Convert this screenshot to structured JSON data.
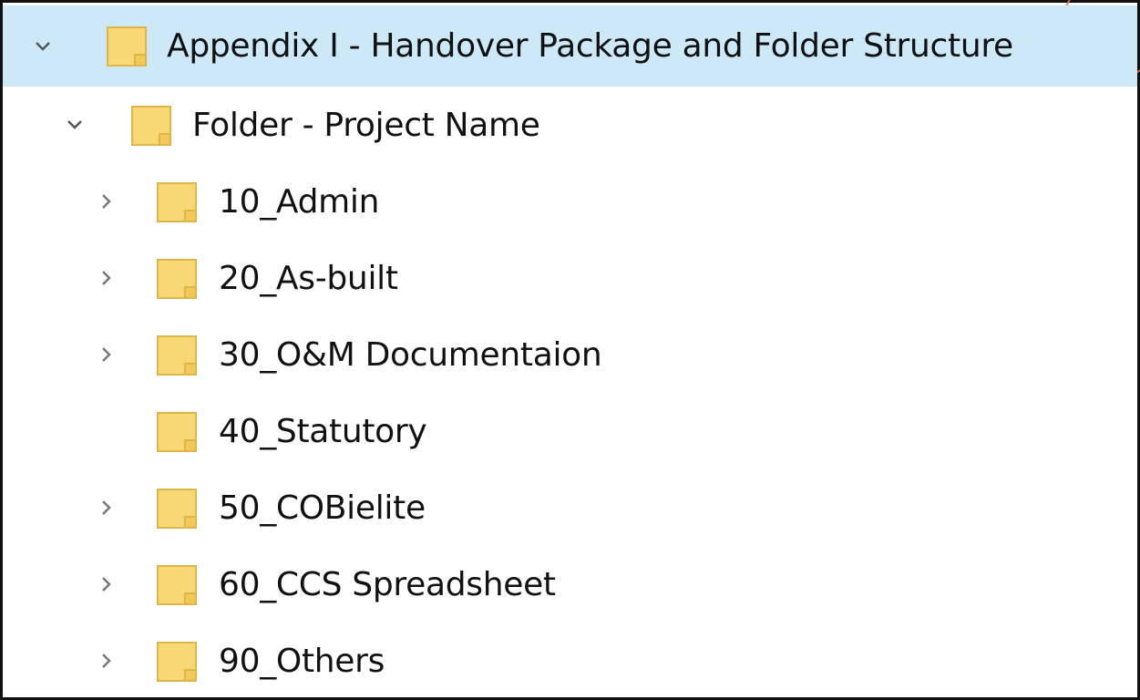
{
  "tree": {
    "items": [
      {
        "label": "Appendix I - Handover Package and Folder Structure",
        "expander": "chevron-down",
        "selected": true,
        "level": 0
      },
      {
        "label": "Folder - Project Name",
        "expander": "chevron-down",
        "selected": false,
        "level": 1
      },
      {
        "label": "10_Admin",
        "expander": "chevron-right",
        "selected": false,
        "level": 2
      },
      {
        "label": "20_As-built",
        "expander": "chevron-right",
        "selected": false,
        "level": 2
      },
      {
        "label": "30_O&M Documentaion",
        "expander": "chevron-right",
        "selected": false,
        "level": 2
      },
      {
        "label": "40_Statutory",
        "expander": "none",
        "selected": false,
        "level": 2
      },
      {
        "label": "50_COBielite",
        "expander": "chevron-right",
        "selected": false,
        "level": 2
      },
      {
        "label": "60_CCS Spreadsheet",
        "expander": "chevron-right",
        "selected": false,
        "level": 2
      },
      {
        "label": "90_Others",
        "expander": "chevron-right",
        "selected": false,
        "level": 2
      }
    ]
  },
  "colors": {
    "selection": "#cde8f7",
    "folder_fill": "#f8d775",
    "folder_edge": "#e0b548",
    "chevron": "#555555"
  }
}
